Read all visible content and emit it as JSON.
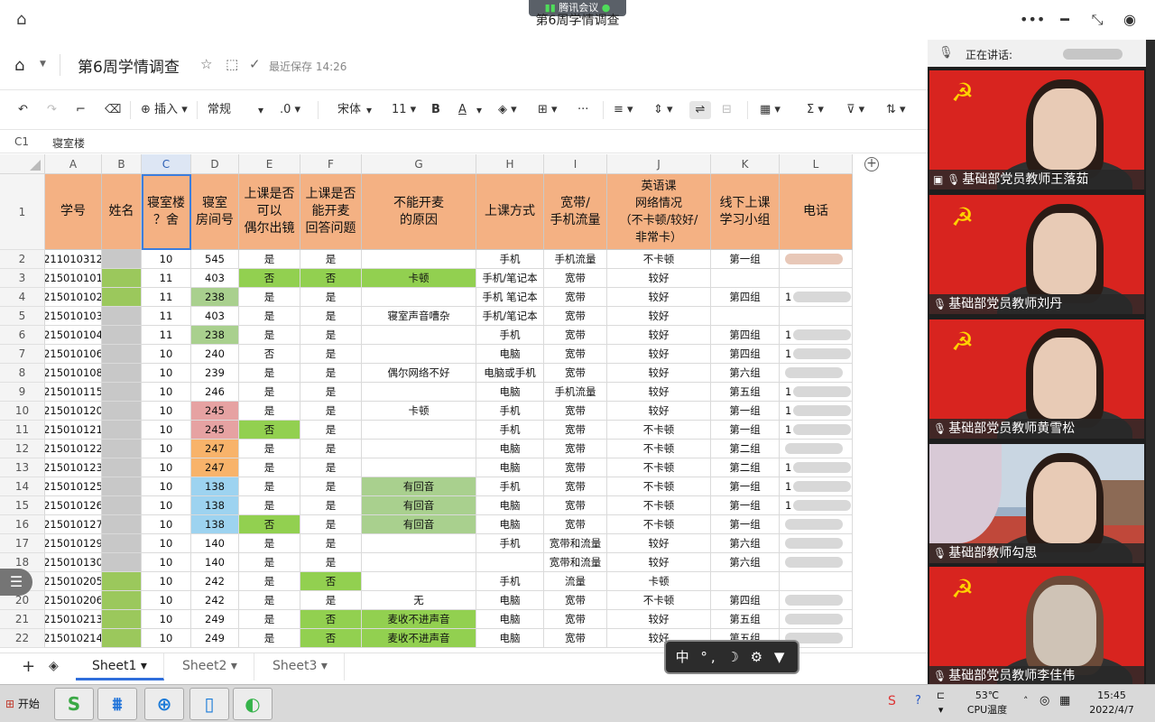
{
  "window": {
    "title": "第6周学情调查",
    "meeting_badge": "腾讯会议"
  },
  "doc": {
    "title": "第6周学情调查",
    "saved": "最近保存 14:26"
  },
  "toolbar": {
    "insert": "插入",
    "format": "常规",
    "decimal": ".0",
    "font": "宋体",
    "size": "11",
    "bold": "B",
    "underline": "A",
    "more": "···"
  },
  "formula": {
    "ref": "C1",
    "value": "寝室楼"
  },
  "columns": [
    "A",
    "B",
    "C",
    "D",
    "E",
    "F",
    "G",
    "H",
    "I",
    "J",
    "K",
    "L"
  ],
  "header_row": [
    "学号",
    "姓名",
    "寝室楼\n？舍",
    "寝室\n房间号",
    "上课是否\n可以\n偶尔出镜",
    "上课是否\n能开麦\n回答问题",
    "不能开麦\n的原因",
    "上课方式",
    "宽带/\n手机流量",
    "英语课\n网络情况\n（不卡顿/较好/\n非常卡）",
    "线下上课\n学习小组",
    "电话"
  ],
  "row_numbers": [
    "1",
    "2",
    "3",
    "4",
    "5",
    "6",
    "7",
    "8",
    "9",
    "10",
    "11",
    "12",
    "13",
    "14",
    "15",
    "16",
    "17",
    "18",
    "19",
    "20",
    "21",
    "22"
  ],
  "rows": [
    [
      "211010312",
      "",
      "10",
      "545",
      "是",
      "是",
      "",
      "手机",
      "手机流量",
      "不卡顿",
      "第一组",
      ""
    ],
    [
      "215010101",
      "",
      "11",
      "403",
      "否",
      "否",
      "卡顿",
      "手机/笔记本",
      "宽带",
      "较好",
      "",
      ""
    ],
    [
      "215010102",
      "",
      "11",
      "238",
      "是",
      "是",
      "",
      "手机 笔记本",
      "宽带",
      "较好",
      "第四组",
      "1"
    ],
    [
      "215010103",
      "",
      "11",
      "403",
      "是",
      "是",
      "寝室声音嘈杂",
      "手机/笔记本",
      "宽带",
      "较好",
      "",
      ""
    ],
    [
      "215010104",
      "",
      "11",
      "238",
      "是",
      "是",
      "",
      "手机",
      "宽带",
      "较好",
      "第四组",
      "1"
    ],
    [
      "215010106",
      "",
      "10",
      "240",
      "否",
      "是",
      "",
      "电脑",
      "宽带",
      "较好",
      "第四组",
      "1"
    ],
    [
      "215010108",
      "",
      "10",
      "239",
      "是",
      "是",
      "偶尔网络不好",
      "电脑或手机",
      "宽带",
      "较好",
      "第六组",
      ""
    ],
    [
      "215010115",
      "",
      "10",
      "246",
      "是",
      "是",
      "",
      "电脑",
      "手机流量",
      "较好",
      "第五组",
      "1"
    ],
    [
      "215010120",
      "",
      "10",
      "245",
      "是",
      "是",
      "卡顿",
      "手机",
      "宽带",
      "较好",
      "第一组",
      "1"
    ],
    [
      "215010121",
      "",
      "10",
      "245",
      "否",
      "是",
      "",
      "手机",
      "宽带",
      "不卡顿",
      "第一组",
      "1"
    ],
    [
      "215010122",
      "",
      "10",
      "247",
      "是",
      "是",
      "",
      "电脑",
      "宽带",
      "不卡顿",
      "第二组",
      ""
    ],
    [
      "215010123",
      "",
      "10",
      "247",
      "是",
      "是",
      "",
      "电脑",
      "宽带",
      "不卡顿",
      "第二组",
      "1"
    ],
    [
      "215010125",
      "",
      "10",
      "138",
      "是",
      "是",
      "有回音",
      "手机",
      "宽带",
      "不卡顿",
      "第一组",
      "1"
    ],
    [
      "215010126",
      "",
      "10",
      "138",
      "是",
      "是",
      "有回音",
      "电脑",
      "宽带",
      "不卡顿",
      "第一组",
      "1"
    ],
    [
      "215010127",
      "",
      "10",
      "138",
      "否",
      "是",
      "有回音",
      "电脑",
      "宽带",
      "不卡顿",
      "第一组",
      ""
    ],
    [
      "215010129",
      "",
      "10",
      "140",
      "是",
      "是",
      "",
      "手机",
      "宽带和流量",
      "较好",
      "第六组",
      ""
    ],
    [
      "215010130",
      "",
      "10",
      "140",
      "是",
      "是",
      "",
      "",
      "宽带和流量",
      "较好",
      "第六组",
      ""
    ],
    [
      "215010205",
      "",
      "10",
      "242",
      "是",
      "否",
      "",
      "手机",
      "流量",
      "卡顿",
      "",
      ""
    ],
    [
      "215010206",
      "",
      "10",
      "242",
      "是",
      "是",
      "无",
      "电脑",
      "宽带",
      "不卡顿",
      "第四组",
      ""
    ],
    [
      "215010213",
      "",
      "10",
      "249",
      "是",
      "否",
      "麦收不进声音",
      "电脑",
      "宽带",
      "较好",
      "第五组",
      ""
    ],
    [
      "215010214",
      "",
      "10",
      "249",
      "是",
      "否",
      "麦收不进声音",
      "电脑",
      "宽带",
      "较好",
      "第五组",
      ""
    ]
  ],
  "sheets": [
    "Sheet1",
    "Sheet2",
    "Sheet3"
  ],
  "meeting": {
    "speaking_label": "正在讲话:",
    "participants": [
      "基础部党员教师王落茹",
      "基础部党员教师刘丹",
      "基础部党员教师黄雪松",
      "基础部教师勾思",
      "基础部党员教师李佳伟"
    ]
  },
  "taskbar": {
    "start": "开始",
    "temp": "53℃",
    "temp_label": "CPU温度",
    "time": "15:45",
    "date": "2022/4/7"
  },
  "colors": {
    "header_fill": "#f4b183",
    "green": "#92d050",
    "light_green": "#a9d08e",
    "pink": "#e6a2a2",
    "orange": "#f8b36a",
    "blue": "#9dd3f0",
    "accent": "#2f6edb"
  }
}
